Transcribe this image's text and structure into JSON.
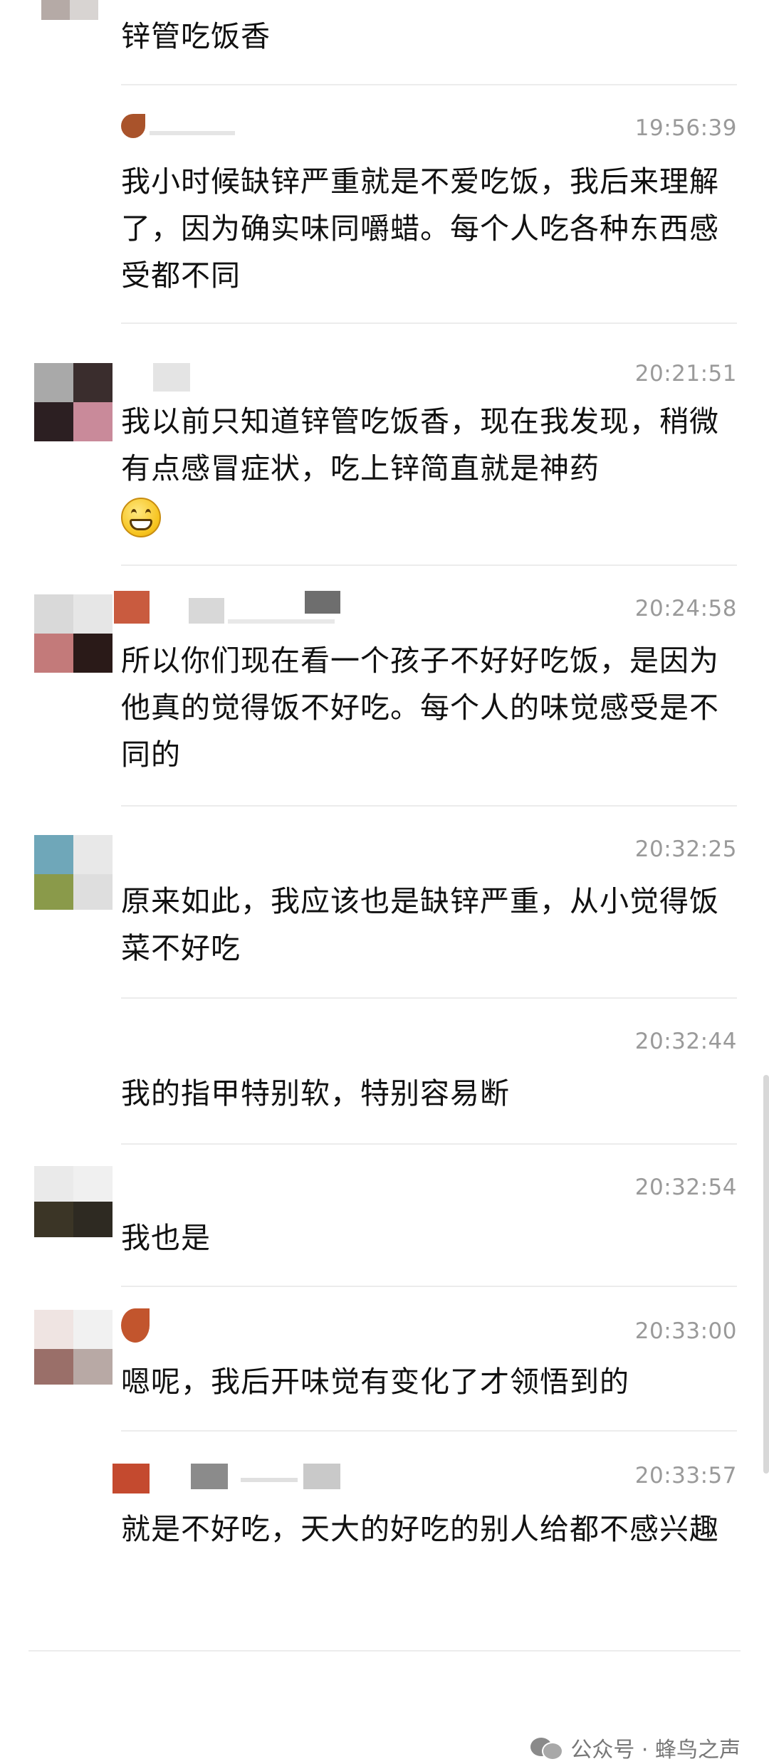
{
  "messages": [
    {
      "time": "",
      "text": "锌管吃饭香"
    },
    {
      "time": "19:56:39",
      "text": "我小时候缺锌严重就是不爱吃饭，我后来理解了，因为确实味同嚼蜡。每个人吃各种东西感受都不同"
    },
    {
      "time": "20:21:51",
      "text": "我以前只知道锌管吃饭香，现在我发现，稍微有点感冒症状，吃上锌简直就是神药",
      "emoji": "grinning-face"
    },
    {
      "time": "20:24:58",
      "text": "所以你们现在看一个孩子不好好吃饭，是因为他真的觉得饭不好吃。每个人的味觉感受是不同的"
    },
    {
      "time": "20:32:25",
      "text": "原来如此，我应该也是缺锌严重，从小觉得饭菜不好吃"
    },
    {
      "time": "20:32:44",
      "text": "我的指甲特别软，特别容易断"
    },
    {
      "time": "20:32:54",
      "text": "我也是"
    },
    {
      "time": "20:33:00",
      "text": "嗯呢，我后开味觉有变化了才领悟到的"
    },
    {
      "time": "20:33:57",
      "text": "就是不好吃，天大的好吃的别人给都不感兴趣"
    }
  ],
  "watermark": {
    "icon": "wechat-icon",
    "text": "公众号 · 蜂鸟之声"
  }
}
